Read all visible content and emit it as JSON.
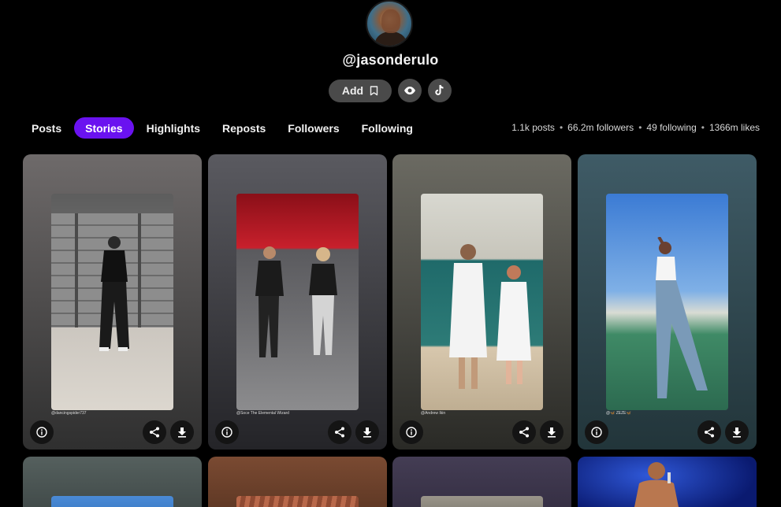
{
  "profile": {
    "username": "@jasonderulo",
    "add_label": "Add"
  },
  "tabs": [
    {
      "label": "Posts"
    },
    {
      "label": "Stories"
    },
    {
      "label": "Highlights"
    },
    {
      "label": "Reposts"
    },
    {
      "label": "Followers"
    },
    {
      "label": "Following"
    }
  ],
  "active_tab": "Stories",
  "stats": {
    "posts": "1.1k posts",
    "followers": "66.2m followers",
    "following": "49 following",
    "likes": "1366m likes"
  },
  "stories": [
    {
      "credit": "@dancingspider737"
    },
    {
      "credit": "@Soce The Elemental Wizard"
    },
    {
      "credit": "@Andrew Ikin"
    },
    {
      "credit": "@🦋 ZEZE🦋"
    }
  ],
  "colors": {
    "accent": "#6a12f0",
    "button_bg": "#4a4a4a",
    "background": "#000000"
  }
}
